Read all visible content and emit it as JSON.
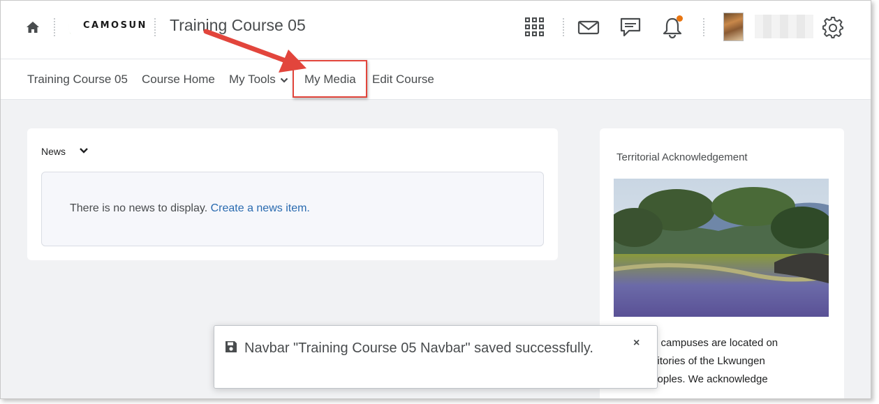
{
  "header": {
    "logo_text": "CAMOSUN",
    "course_title": "Training Course 05",
    "notification_color": "#e87511",
    "icons": [
      "home-icon",
      "waffle-icon",
      "mail-icon",
      "chat-icon",
      "bell-icon",
      "gear-icon"
    ]
  },
  "navbar": {
    "items": [
      {
        "label": "Training Course 05"
      },
      {
        "label": "Course Home"
      },
      {
        "label": "My Tools"
      },
      {
        "label": "My Media"
      },
      {
        "label": "Edit Course"
      }
    ],
    "highlight_color": "#e2453c"
  },
  "news": {
    "title": "News",
    "empty_text": "There is no news to display.",
    "create_link": "Create a news item."
  },
  "territorial": {
    "title": "Territorial Acknowledgement",
    "lines": [
      "n College campuses are located on",
      "tional territories of the Lkwungen",
      "ANEĆ peoples. We acknowledge"
    ]
  },
  "toast": {
    "message": "Navbar \"Training Course 05 Navbar\" saved successfully.",
    "close": "×"
  },
  "colors": {
    "link": "#2a6bb0",
    "page_bg": "#f1f2f4",
    "brand_green": "#7ab648"
  }
}
